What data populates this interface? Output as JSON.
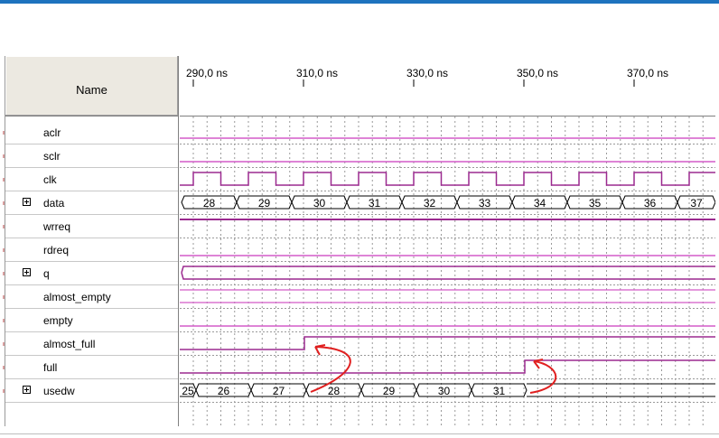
{
  "name_header": "Name",
  "time_labels": [
    "290,0 ns",
    "310,0 ns",
    "330,0 ns",
    "350,0 ns",
    "370,0 ns"
  ],
  "signals": [
    {
      "name": "aclr",
      "expandable": false
    },
    {
      "name": "sclr",
      "expandable": false
    },
    {
      "name": "clk",
      "expandable": false
    },
    {
      "name": "data",
      "expandable": true
    },
    {
      "name": "wrreq",
      "expandable": false
    },
    {
      "name": "rdreq",
      "expandable": false
    },
    {
      "name": "q",
      "expandable": true
    },
    {
      "name": "almost_empty",
      "expandable": false
    },
    {
      "name": "empty",
      "expandable": false
    },
    {
      "name": "almost_full",
      "expandable": false
    },
    {
      "name": "full",
      "expandable": false
    },
    {
      "name": "usedw",
      "expandable": true
    }
  ],
  "data_bus_values": [
    "28",
    "29",
    "30",
    "31",
    "32",
    "33",
    "34",
    "35",
    "36",
    "37"
  ],
  "usedw_bus_values": [
    "25",
    "26",
    "27",
    "28",
    "29",
    "30",
    "31"
  ],
  "colors": {
    "wave": "#9b2a8f",
    "wave_low": "#d35bc8",
    "grid": "#9a9a9a",
    "arrow": "#e02020",
    "header_bg": "#ece9e1",
    "top_bar": "#1e73be"
  }
}
